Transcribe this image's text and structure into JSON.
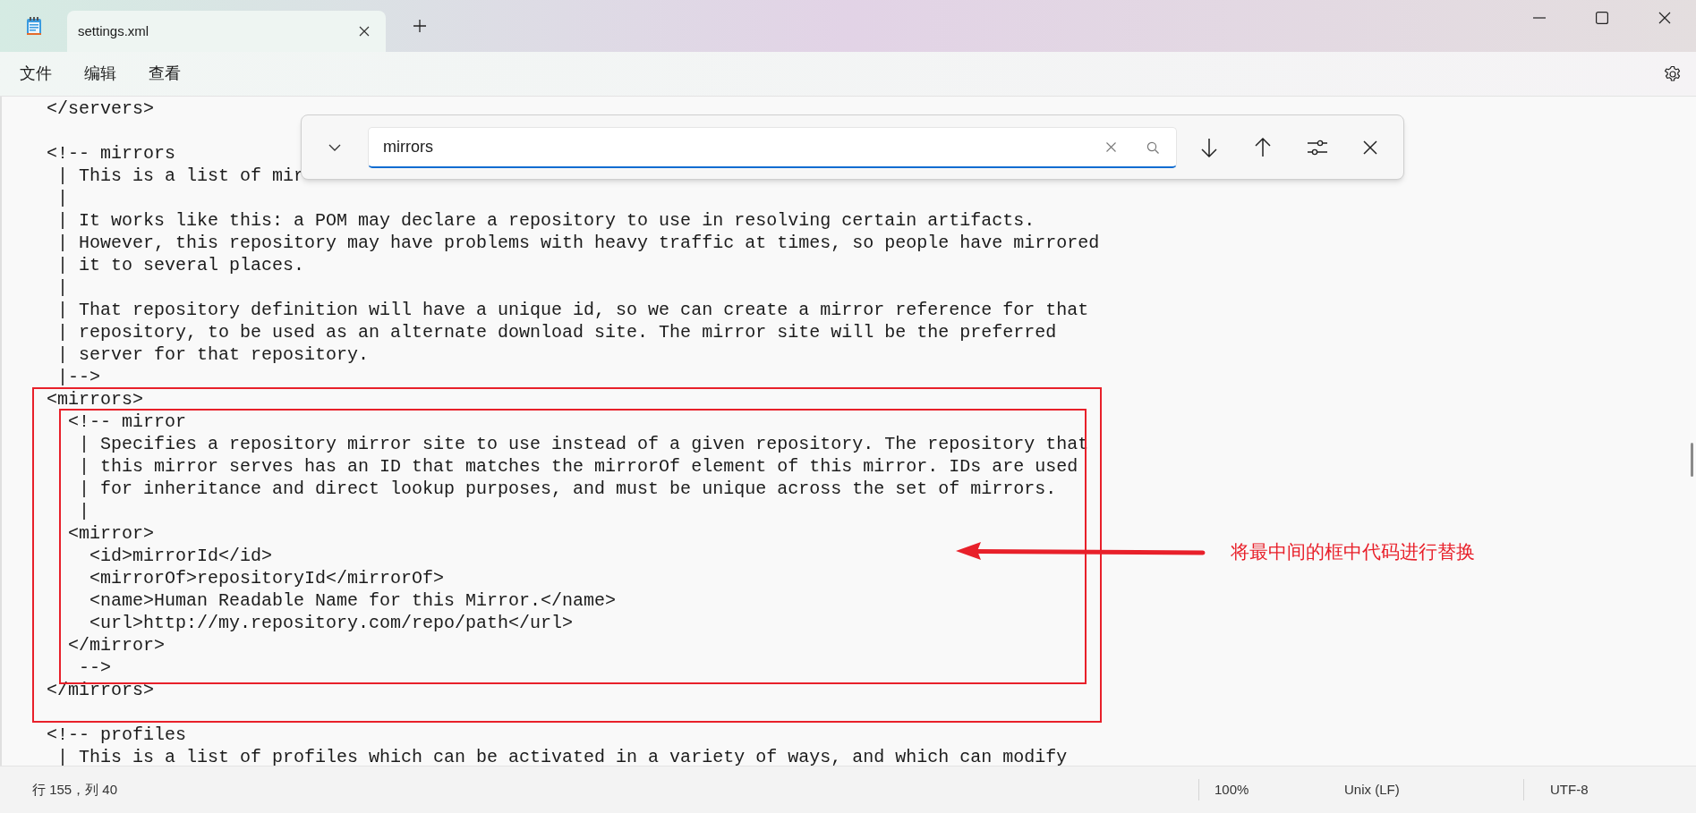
{
  "tabs": [
    {
      "label": "settings.xml",
      "selected": true
    }
  ],
  "menu": [
    "文件",
    "编辑",
    "查看"
  ],
  "find": {
    "value": "mirrors"
  },
  "editor": {
    "blocks": [
      [
        "    </servers>"
      ],
      [
        "    <!-- mirrors",
        "     | This is a list of mir",
        "     |",
        "     | It works like this: a POM may declare a repository to use in resolving certain artifacts.",
        "     | However, this repository may have problems with heavy traffic at times, so people have mirrored",
        "     | it to several places.",
        "     |",
        "     | That repository definition will have a unique id, so we can create a mirror reference for that",
        "     | repository, to be used as an alternate download site. The mirror site will be the preferred",
        "     | server for that repository.",
        "     |-->",
        "    <mirrors>",
        "      <!-- mirror",
        "       | Specifies a repository mirror site to use instead of a given repository. The repository that",
        "       | this mirror serves has an ID that matches the mirrorOf element of this mirror. IDs are used",
        "       | for inheritance and direct lookup purposes, and must be unique across the set of mirrors.",
        "       |",
        "      <mirror>",
        "        <id>mirrorId</id>",
        "        <mirrorOf>repositoryId</mirrorOf>",
        "        <name>Human Readable Name for this Mirror.</name>",
        "        <url>http://my.repository.com/repo/path</url>",
        "      </mirror>",
        "       -->",
        "    </mirrors>"
      ],
      [
        "    <!-- profiles",
        "     | This is a list of profiles which can be activated in a variety of ways, and which can modify"
      ]
    ]
  },
  "annotation": {
    "text": "将最中间的框中代码进行替换"
  },
  "status_bar": {
    "position": "行 155，列 40",
    "zoom": "100%",
    "line_ending": "Unix (LF)",
    "encoding": "UTF-8"
  }
}
